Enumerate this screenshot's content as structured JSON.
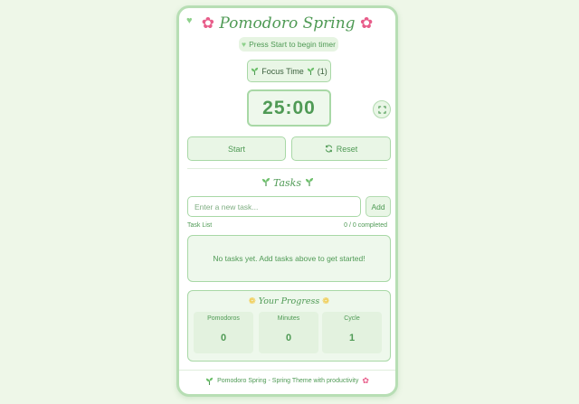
{
  "header": {
    "title": "Pomodoro Spring",
    "status": "Press Start to begin timer"
  },
  "timer": {
    "mode_label": "Focus Time",
    "mode_count": "(1)",
    "display": "25:00"
  },
  "controls": {
    "start_label": "Start",
    "reset_label": "Reset"
  },
  "tasks": {
    "title": "Tasks",
    "input_placeholder": "Enter a new task...",
    "add_label": "Add",
    "list_label": "Task List",
    "count_text": "0 / 0 completed",
    "empty_message": "No tasks yet. Add tasks above to get started!"
  },
  "progress": {
    "title": "Your Progress",
    "stats": [
      {
        "label": "Pomodoros",
        "value": "0"
      },
      {
        "label": "Minutes",
        "value": "0"
      },
      {
        "label": "Cycle",
        "value": "1"
      }
    ]
  },
  "footer": {
    "text": "Pomodoro Spring - Spring Theme with productivity"
  },
  "icons": {
    "corner": "heart-icon",
    "title_flowers": "cherry-blossom-icon",
    "sprout": "seedling-icon",
    "progress": "sunflower-icon",
    "reset": "refresh-icon",
    "fullscreen": "expand-icon"
  },
  "colors": {
    "accent": "#4f9a55",
    "border": "#a8d8a6",
    "background": "#eef7e8",
    "flower": "#e85d8a",
    "sunflower": "#f2c230"
  }
}
